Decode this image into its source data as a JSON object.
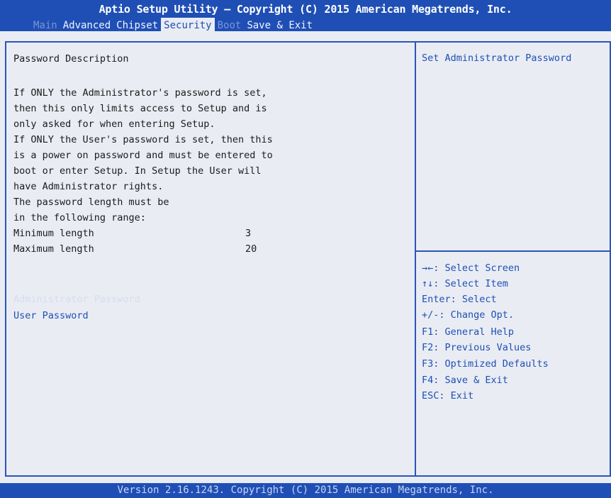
{
  "header": {
    "title": "Aptio Setup Utility – Copyright (C) 2015 American Megatrends, Inc.",
    "tabs": [
      {
        "label": "Main",
        "state": "dim"
      },
      {
        "label": "Advanced",
        "state": "normal"
      },
      {
        "label": "Chipset",
        "state": "normal"
      },
      {
        "label": "Security",
        "state": "active"
      },
      {
        "label": "Boot",
        "state": "dim"
      },
      {
        "label": "Save & Exit",
        "state": "normal"
      }
    ]
  },
  "main": {
    "heading": "Password Description",
    "description": [
      "If ONLY the Administrator's password is set,",
      "then this only limits access to Setup and is",
      "only asked for when entering Setup.",
      "If ONLY the User's password is set, then this",
      "is a power on password and must be entered to",
      "boot or enter Setup. In Setup the User will",
      "have Administrator rights.",
      "The password length must be",
      "in the following range:"
    ],
    "min_label": "Minimum length",
    "min_value": "3",
    "max_label": "Maximum length",
    "max_value": "20",
    "items": [
      {
        "label": "Administrator Password",
        "selected": true
      },
      {
        "label": "User Password",
        "selected": false
      }
    ]
  },
  "help": {
    "title": "Set Administrator Password",
    "keys": [
      "→←: Select Screen",
      "↑↓: Select Item",
      "Enter: Select",
      "+/-: Change Opt.",
      "F1: General Help",
      "F2: Previous Values",
      "F3: Optimized Defaults",
      "F4: Save & Exit",
      "ESC: Exit"
    ]
  },
  "footer": {
    "text": "Version 2.16.1243. Copyright (C) 2015 American Megatrends, Inc."
  },
  "colors": {
    "header_blue": "#1f4fb5",
    "background": "#e9ecf3",
    "text_blue": "#1f4fb5",
    "text_dark": "#1b1b1b"
  }
}
